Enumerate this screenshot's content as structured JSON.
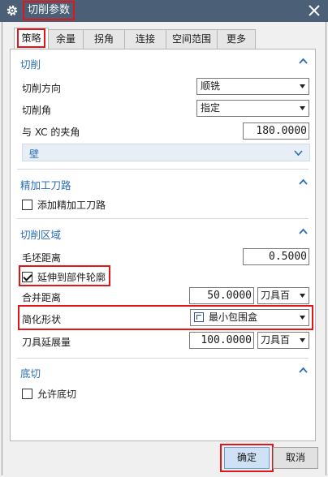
{
  "window": {
    "title": "切削参数"
  },
  "tabs": [
    {
      "label": "策略",
      "active": true
    },
    {
      "label": "余量",
      "active": false
    },
    {
      "label": "拐角",
      "active": false
    },
    {
      "label": "连接",
      "active": false
    },
    {
      "label": "空间范围",
      "active": false
    },
    {
      "label": "更多",
      "active": false
    }
  ],
  "cut": {
    "title": "切削",
    "direction": {
      "label": "切削方向",
      "value": "顺铣"
    },
    "angle": {
      "label": "切削角",
      "value": "指定"
    },
    "xc_angle": {
      "label": "与 XC 的夹角",
      "value": "180.0000"
    },
    "wall": {
      "label": "壁"
    }
  },
  "finish": {
    "title": "精加工刀路",
    "add_pass": {
      "label": "添加精加工刀路",
      "checked": false
    }
  },
  "region": {
    "title": "切削区域",
    "blank_distance": {
      "label": "毛坯距离",
      "value": "0.5000"
    },
    "extend": {
      "label": "延伸到部件轮廓",
      "checked": true
    },
    "merge": {
      "label": "合并距离",
      "value": "50.0000",
      "unit": "刀具百"
    },
    "simplify": {
      "label": "简化形状",
      "value": "最小包围盒"
    },
    "extension": {
      "label": "刀具延展量",
      "value": "100.0000",
      "unit": "刀具百"
    }
  },
  "undercut": {
    "title": "底切",
    "allow": {
      "label": "允许底切",
      "checked": false
    }
  },
  "footer": {
    "ok": "确定",
    "cancel": "取消"
  },
  "colors": {
    "titlebar": "#4b5f76",
    "section": "#2a6db5",
    "highlight": "#e0161b"
  }
}
